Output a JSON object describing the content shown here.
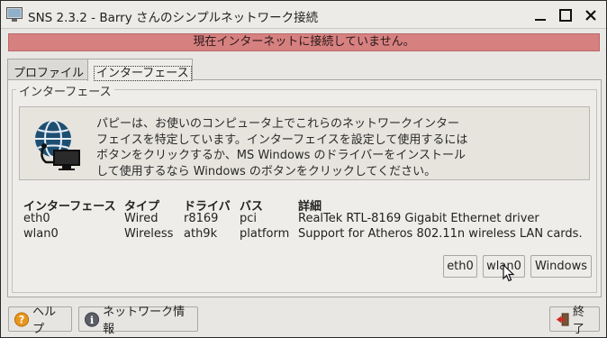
{
  "window": {
    "title": "SNS 2.3.2 - Barry さんのシンプルネットワーク接続"
  },
  "banner": {
    "text": "現在インターネットに接続していません。",
    "color": "#d78080"
  },
  "tabs": [
    {
      "label": "プロファイル",
      "active": false
    },
    {
      "label": "インターフェース",
      "active": true
    }
  ],
  "group": {
    "title": "インターフェース"
  },
  "info": {
    "lines": [
      "パピーは、お使いのコンピュータ上でこれらのネットワークインター",
      "フェイスを特定しています。インターフェイスを設定して使用するには",
      "ボタンをクリックするか、MS Windows のドライバーをインストール",
      "して使用するなら Windows のボタンをクリックしてください。"
    ]
  },
  "interfaces": {
    "headers": [
      "インターフェース",
      "タイプ",
      "ドライバ",
      "バス",
      "詳細"
    ],
    "rows": [
      [
        "eth0",
        "Wired",
        "r8169",
        "pci",
        "RealTek RTL-8169 Gigabit Ethernet driver"
      ],
      [
        "wlan0",
        "Wireless",
        "ath9k",
        "platform",
        "Support for Atheros 802.11n wireless LAN cards."
      ]
    ]
  },
  "interface_buttons": [
    "eth0",
    "wlan0",
    "Windows"
  ],
  "bottom": {
    "help_label": "ヘルプ",
    "netinfo_label": "ネットワーク情報",
    "quit_label": "終了"
  },
  "icons": {
    "help": "help-icon",
    "info": "info-icon",
    "quit": "quit-icon",
    "network": "network-globe-monitor-icon"
  }
}
